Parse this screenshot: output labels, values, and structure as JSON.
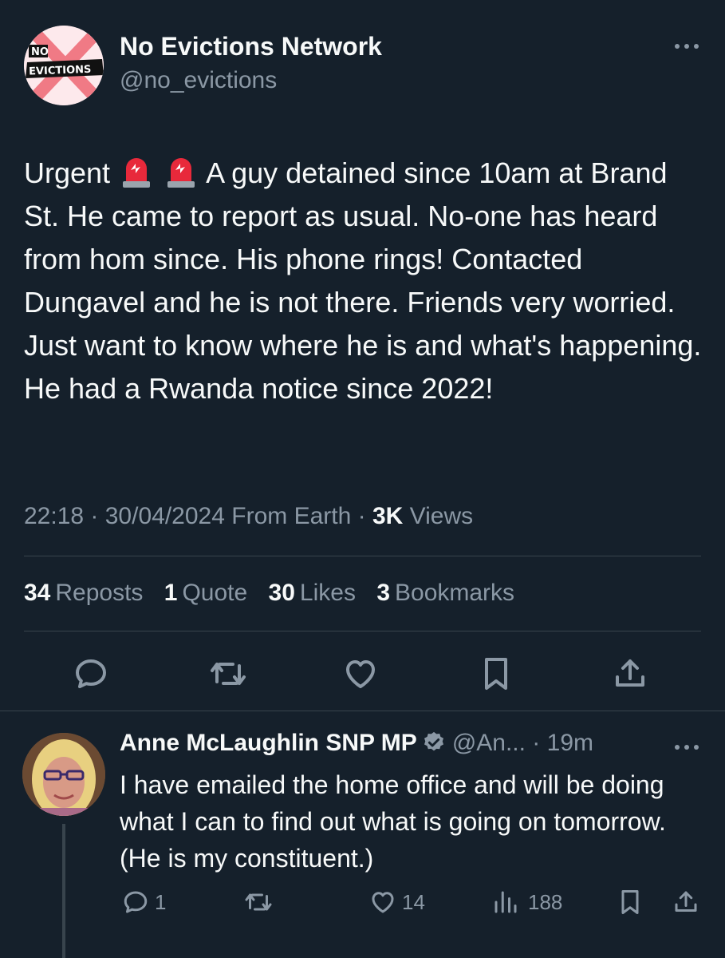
{
  "tweet": {
    "author": {
      "name": "No Evictions Network",
      "handle": "@no_evictions",
      "avatar_text_top": "NO",
      "avatar_text_bottom": "EVICTIONS"
    },
    "text_part1": "Urgent",
    "text_part2": "A guy detained since 10am at Brand St. He came to report as usual. No-one has heard from hom since. His phone rings! Contacted Dungavel and he is not there. Friends very worried. Just want to know where he is and what's happening. He had a Rwanda notice since 2022!",
    "time": "22:18",
    "date": "30/04/2024",
    "source": "From Earth",
    "views_count": "3K",
    "views_label": "Views",
    "stats": {
      "reposts_count": "34",
      "reposts_label": "Reposts",
      "quote_count": "1",
      "quote_label": "Quote",
      "likes_count": "30",
      "likes_label": "Likes",
      "bookmarks_count": "3",
      "bookmarks_label": "Bookmarks"
    }
  },
  "reply": {
    "name": "Anne McLaughlin SNP MP",
    "handle": "@An...",
    "time": "19m",
    "text": "I have emailed the home office and will be doing what I can to find out what is going on tomorrow. (He is my constituent.)",
    "reply_count": "1",
    "like_count": "14",
    "view_count": "188"
  },
  "icons": {
    "more": "more-dots-icon",
    "siren": "police-siren-emoji",
    "verified": "verified-badge-icon",
    "reply": "reply-bubble-icon",
    "repost": "repost-arrows-icon",
    "like": "heart-icon",
    "bookmark": "bookmark-icon",
    "share": "share-upload-icon",
    "views": "views-bars-icon"
  },
  "colors": {
    "background": "#15202b",
    "text_primary": "#f7f9f9",
    "text_secondary": "#8b98a5",
    "divider": "#38444d",
    "verified": "#8b98a5",
    "avatar_x": "#f07a85"
  }
}
